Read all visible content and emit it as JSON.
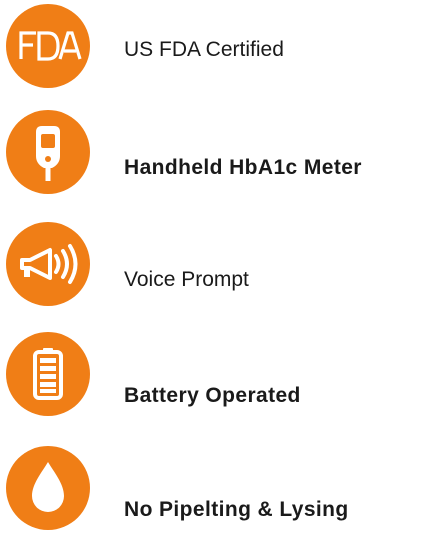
{
  "colors": {
    "accent": "#F07E16",
    "icon_fill": "#FFFFFF",
    "text": "#1A1A1A",
    "background": "#FFFFFF"
  },
  "features": [
    {
      "label": "US FDA Certified",
      "icon": "fda-logo-icon",
      "emphasis": "regular"
    },
    {
      "label": "Handheld HbA1c Meter",
      "icon": "handheld-meter-icon",
      "emphasis": "bold"
    },
    {
      "label": "Voice Prompt",
      "icon": "speaker-voice-icon",
      "emphasis": "regular"
    },
    {
      "label": "Battery Operated",
      "icon": "battery-icon",
      "emphasis": "bold"
    },
    {
      "label": "No Pipelting & Lysing",
      "icon": "water-drop-icon",
      "emphasis": "bold"
    }
  ],
  "fda_logo": {
    "text": "FDA"
  }
}
